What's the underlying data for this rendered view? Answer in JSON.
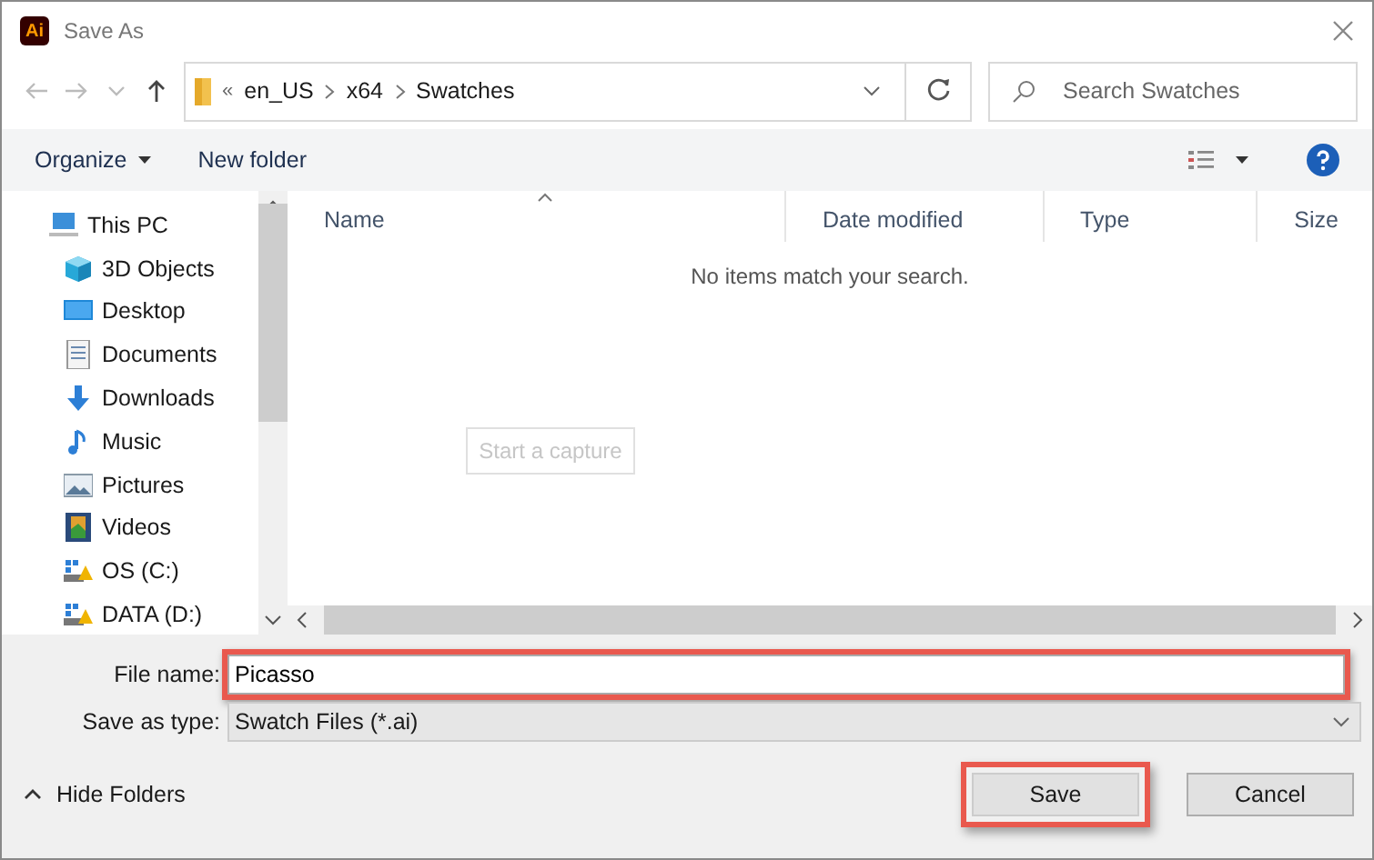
{
  "window": {
    "title": "Save As",
    "app_icon": "Ai"
  },
  "address": {
    "overflow": "«",
    "crumbs": [
      "en_US",
      "x64",
      "Swatches"
    ]
  },
  "search": {
    "placeholder": "Search Swatches"
  },
  "toolbar": {
    "organize": "Organize",
    "new_folder": "New folder"
  },
  "sidebar": {
    "items": [
      {
        "label": "This PC",
        "kind": "pc",
        "children": [
          {
            "label": "3D Objects",
            "kind": "cube"
          },
          {
            "label": "Desktop",
            "kind": "desktop"
          },
          {
            "label": "Documents",
            "kind": "document"
          },
          {
            "label": "Downloads",
            "kind": "download"
          },
          {
            "label": "Music",
            "kind": "music"
          },
          {
            "label": "Pictures",
            "kind": "pictures"
          },
          {
            "label": "Videos",
            "kind": "video"
          },
          {
            "label": "OS (C:)",
            "kind": "drive"
          },
          {
            "label": "DATA (D:)",
            "kind": "drive"
          }
        ]
      }
    ]
  },
  "table": {
    "columns": [
      {
        "label": "Name",
        "sorted": true
      },
      {
        "label": "Date modified",
        "sorted": false
      },
      {
        "label": "Type",
        "sorted": false
      },
      {
        "label": "Size",
        "sorted": false
      }
    ],
    "empty_message": "No items match your search.",
    "overlay_button": "Start a capture"
  },
  "form": {
    "file_name_label": "File name:",
    "file_name": "Picasso",
    "file_name_highlighted": true,
    "type_label": "Save as type:",
    "type_value": "Swatch Files (*.ai)"
  },
  "footer": {
    "hide_folders": "Hide Folders",
    "buttons": [
      {
        "label": "Save",
        "highlighted": true
      },
      {
        "label": "Cancel",
        "highlighted": false
      }
    ]
  }
}
